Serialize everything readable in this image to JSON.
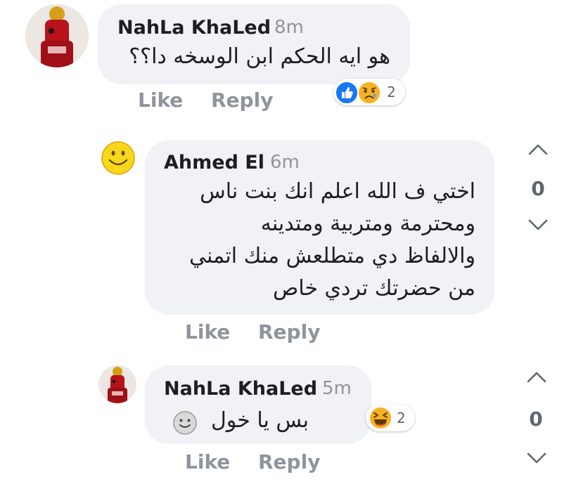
{
  "comments": [
    {
      "author": "NahLa KhaLed",
      "time": "8m",
      "text": "هو ايه الحكم ابن الوسخه دا؟؟",
      "like": "Like",
      "reply": "Reply",
      "reactions": {
        "icons": [
          "like-icon",
          "sad-icon"
        ],
        "count": "2"
      }
    },
    {
      "author": "Ahmed El",
      "time": "6m",
      "lines": [
        "اختي ف الله اعلم انك بنت ناس",
        "ومحترمة ومتربية ومتدينه",
        "والالفاظ دي متطلعش منك اتمني",
        "من حضرتك تردي خاص"
      ],
      "like": "Like",
      "reply": "Reply",
      "votes": "0"
    },
    {
      "author": "NahLa KhaLed",
      "time": "5m",
      "text": "بس يا خول",
      "like": "Like",
      "reply": "Reply",
      "reactions": {
        "icons": [
          "haha-icon"
        ],
        "count": "2"
      },
      "votes": "0"
    }
  ],
  "colors": {
    "bubble": "#f0f2f5",
    "meta": "#90949c",
    "like_blue": "#1877f2",
    "emoji_yellow": "#f7b125"
  }
}
